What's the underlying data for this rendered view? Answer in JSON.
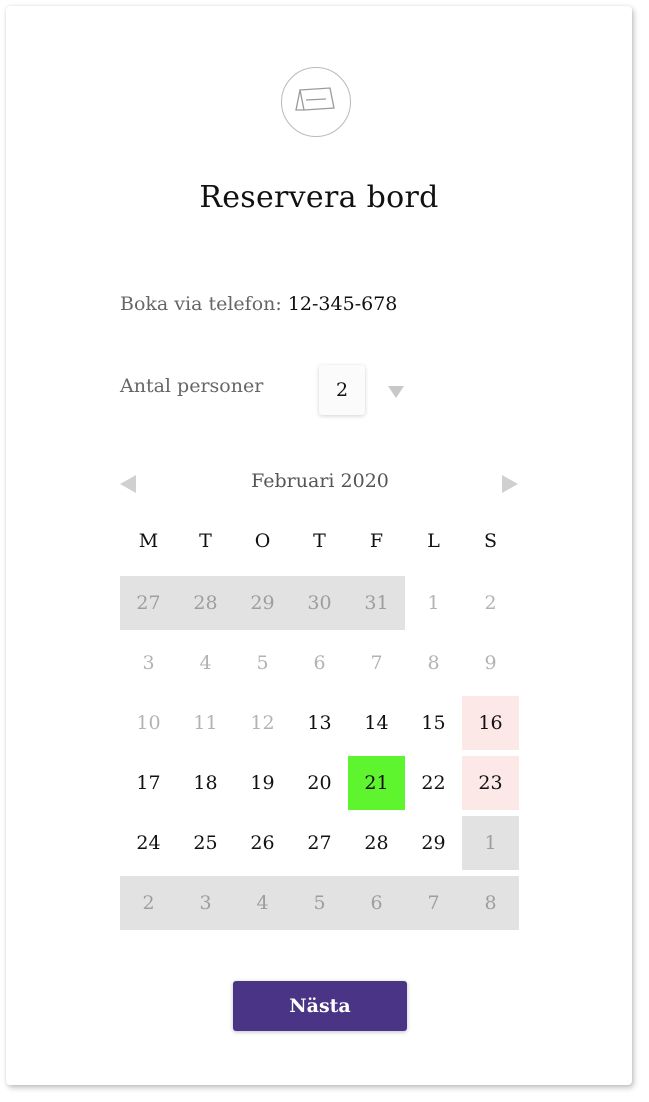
{
  "header": {
    "icon": "table-reservation-card-icon",
    "title": "Reservera bord"
  },
  "phone": {
    "label": "Boka via telefon:",
    "number": "12-345-678"
  },
  "persons": {
    "label": "Antal personer",
    "selected_value": "2"
  },
  "calendar": {
    "month_label": "Februari 2020",
    "weekdays": [
      "M",
      "T",
      "O",
      "T",
      "F",
      "L",
      "S"
    ],
    "weeks": [
      [
        {
          "day": "27",
          "state": "outside"
        },
        {
          "day": "28",
          "state": "outside"
        },
        {
          "day": "29",
          "state": "outside"
        },
        {
          "day": "30",
          "state": "outside"
        },
        {
          "day": "31",
          "state": "outside"
        },
        {
          "day": "1",
          "state": "past"
        },
        {
          "day": "2",
          "state": "past"
        }
      ],
      [
        {
          "day": "3",
          "state": "past"
        },
        {
          "day": "4",
          "state": "past"
        },
        {
          "day": "5",
          "state": "past"
        },
        {
          "day": "6",
          "state": "past"
        },
        {
          "day": "7",
          "state": "past"
        },
        {
          "day": "8",
          "state": "past"
        },
        {
          "day": "9",
          "state": "past"
        }
      ],
      [
        {
          "day": "10",
          "state": "past"
        },
        {
          "day": "11",
          "state": "past"
        },
        {
          "day": "12",
          "state": "past"
        },
        {
          "day": "13",
          "state": "available"
        },
        {
          "day": "14",
          "state": "available"
        },
        {
          "day": "15",
          "state": "available"
        },
        {
          "day": "16",
          "state": "weekend"
        }
      ],
      [
        {
          "day": "17",
          "state": "available"
        },
        {
          "day": "18",
          "state": "available"
        },
        {
          "day": "19",
          "state": "available"
        },
        {
          "day": "20",
          "state": "available"
        },
        {
          "day": "21",
          "state": "selected"
        },
        {
          "day": "22",
          "state": "available"
        },
        {
          "day": "23",
          "state": "weekend"
        }
      ],
      [
        {
          "day": "24",
          "state": "available"
        },
        {
          "day": "25",
          "state": "available"
        },
        {
          "day": "26",
          "state": "available"
        },
        {
          "day": "27",
          "state": "available"
        },
        {
          "day": "28",
          "state": "available"
        },
        {
          "day": "29",
          "state": "available"
        },
        {
          "day": "1",
          "state": "outside"
        }
      ],
      [
        {
          "day": "2",
          "state": "outside"
        },
        {
          "day": "3",
          "state": "outside"
        },
        {
          "day": "4",
          "state": "outside"
        },
        {
          "day": "5",
          "state": "outside"
        },
        {
          "day": "6",
          "state": "outside"
        },
        {
          "day": "7",
          "state": "outside"
        },
        {
          "day": "8",
          "state": "outside"
        }
      ]
    ]
  },
  "actions": {
    "next_label": "Nästa"
  },
  "colors": {
    "accent": "#4a3485",
    "selected_day": "#5ef52f",
    "weekend_day": "#fde8e8",
    "outside_day": "#e2e2e2"
  }
}
